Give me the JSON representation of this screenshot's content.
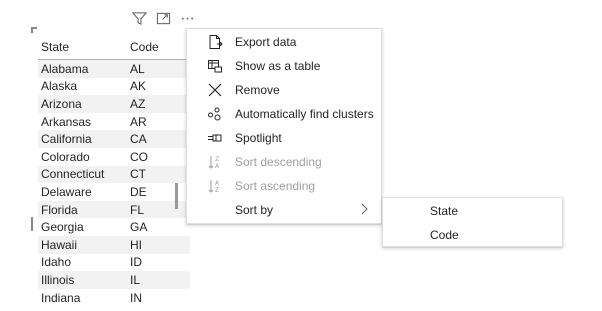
{
  "header_icons": [
    "filter-icon",
    "focus-mode-icon",
    "more-options-icon"
  ],
  "table": {
    "columns": [
      "State",
      "Code"
    ],
    "rows": [
      [
        "Alabama",
        "AL"
      ],
      [
        "Alaska",
        "AK"
      ],
      [
        "Arizona",
        "AZ"
      ],
      [
        "Arkansas",
        "AR"
      ],
      [
        "California",
        "CA"
      ],
      [
        "Colorado",
        "CO"
      ],
      [
        "Connecticut",
        "CT"
      ],
      [
        "Delaware",
        "DE"
      ],
      [
        "Florida",
        "FL"
      ],
      [
        "Georgia",
        "GA"
      ],
      [
        "Hawaii",
        "HI"
      ],
      [
        "Idaho",
        "ID"
      ],
      [
        "Illinois",
        "IL"
      ],
      [
        "Indiana",
        "IN"
      ]
    ]
  },
  "menu": {
    "items": [
      {
        "label": "Export data",
        "icon": "export-data-icon",
        "enabled": true
      },
      {
        "label": "Show as a table",
        "icon": "show-as-table-icon",
        "enabled": true
      },
      {
        "label": "Remove",
        "icon": "remove-icon",
        "enabled": true
      },
      {
        "label": "Automatically find clusters",
        "icon": "clusters-icon",
        "enabled": true
      },
      {
        "label": "Spotlight",
        "icon": "spotlight-icon",
        "enabled": true
      },
      {
        "label": "Sort descending",
        "icon": "sort-descending-icon",
        "enabled": false
      },
      {
        "label": "Sort ascending",
        "icon": "sort-ascending-icon",
        "enabled": false
      },
      {
        "label": "Sort by",
        "icon": "",
        "enabled": true
      }
    ]
  },
  "submenu": {
    "items": [
      "State",
      "Code"
    ]
  },
  "colors": {
    "text": "#252423",
    "disabled_text": "#a19f9d",
    "alt_row": "#f2f2f2",
    "header_border": "#b3b0ad"
  }
}
